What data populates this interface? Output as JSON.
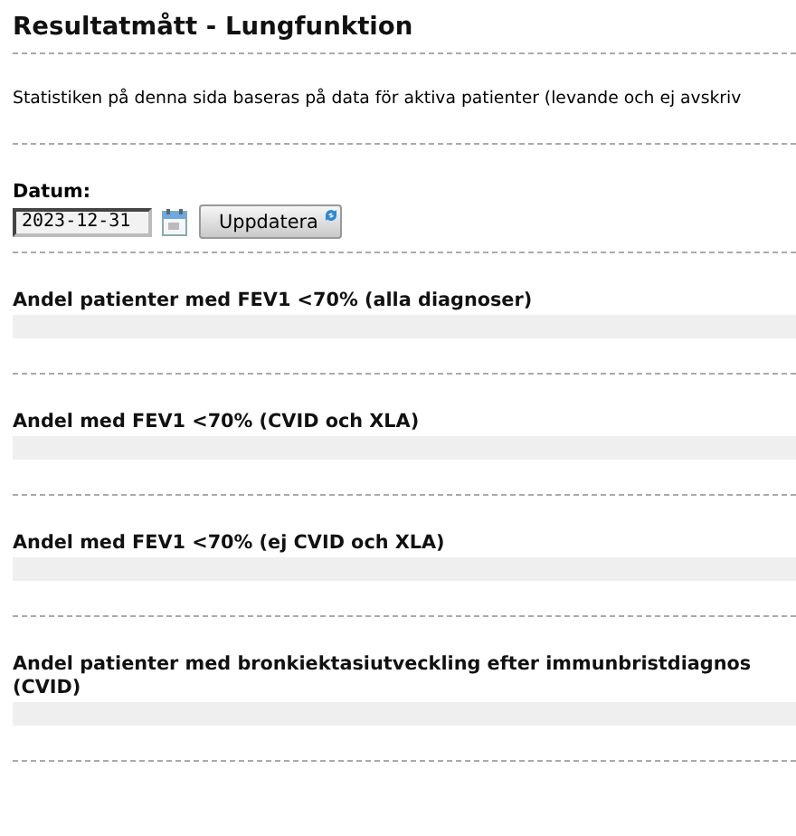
{
  "title": "Resultatmått - Lungfunktion",
  "intro": "Statistiken på denna sida baseras på data för aktiva patienter (levande och ej avskriv",
  "date": {
    "label": "Datum:",
    "value": "2023-12-31"
  },
  "update_button": "Uppdatera",
  "sections": [
    {
      "title": "Andel patienter med FEV1 <70% (alla diagnoser)"
    },
    {
      "title": "Andel med FEV1 <70% (CVID och XLA)"
    },
    {
      "title": "Andel med FEV1 <70% (ej CVID och XLA)"
    },
    {
      "title": "Andel patienter med bronkiektasiutveckling efter immunbristdiagnos (CVID)"
    }
  ]
}
